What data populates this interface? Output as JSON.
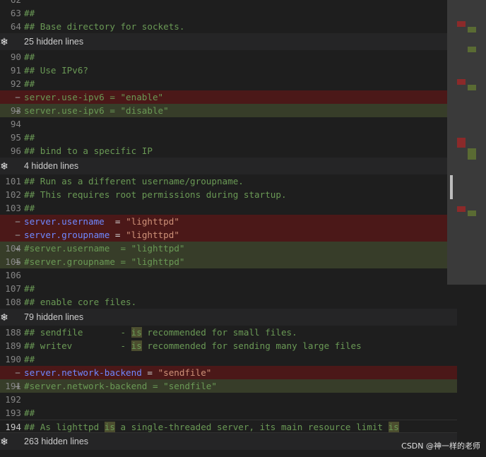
{
  "rows": [
    {
      "num": "62",
      "marker": "",
      "kind": "plain",
      "text": ""
    },
    {
      "num": "63",
      "marker": "",
      "kind": "plain",
      "text": "##"
    },
    {
      "num": "64",
      "marker": "",
      "kind": "plain",
      "text": "## Base directory for sockets."
    },
    {
      "fold": "25 hidden lines"
    },
    {
      "num": "90",
      "marker": "",
      "kind": "plain",
      "text": "##"
    },
    {
      "num": "91",
      "marker": "",
      "kind": "plain",
      "text": "## Use IPv6?"
    },
    {
      "num": "92",
      "marker": "",
      "kind": "plain",
      "text": "##"
    },
    {
      "num": "",
      "marker": "−",
      "kind": "del",
      "text": "server.use-ipv6 = \"enable\""
    },
    {
      "num": "93",
      "marker": "+",
      "kind": "add",
      "text": "server.use-ipv6 = \"disable\""
    },
    {
      "num": "94",
      "marker": "",
      "kind": "plain",
      "text": ""
    },
    {
      "num": "95",
      "marker": "",
      "kind": "plain",
      "text": "##"
    },
    {
      "num": "96",
      "marker": "",
      "kind": "plain",
      "text": "## bind to a specific IP"
    },
    {
      "fold": "4 hidden lines"
    },
    {
      "num": "101",
      "marker": "",
      "kind": "plain",
      "text": "## Run as a different username/groupname."
    },
    {
      "num": "102",
      "marker": "",
      "kind": "plain",
      "text": "## This requires root permissions during startup."
    },
    {
      "num": "103",
      "marker": "",
      "kind": "plain",
      "text": "##"
    },
    {
      "num": "",
      "marker": "−",
      "kind": "del",
      "text": "server.username  = \"lighttpd\""
    },
    {
      "num": "",
      "marker": "−",
      "kind": "del",
      "text": "server.groupname = \"lighttpd\""
    },
    {
      "num": "104",
      "marker": "+",
      "kind": "add",
      "text": "#server.username  = \"lighttpd\""
    },
    {
      "num": "105",
      "marker": "+",
      "kind": "add",
      "text": "#server.groupname = \"lighttpd\""
    },
    {
      "num": "106",
      "marker": "",
      "kind": "plain",
      "text": ""
    },
    {
      "num": "107",
      "marker": "",
      "kind": "plain",
      "text": "##"
    },
    {
      "num": "108",
      "marker": "",
      "kind": "plain",
      "text": "## enable core files."
    },
    {
      "fold": "79 hidden lines"
    },
    {
      "num": "188",
      "marker": "",
      "kind": "plain",
      "text": "## sendfile       - is recommended for small files."
    },
    {
      "num": "189",
      "marker": "",
      "kind": "plain",
      "text": "## writev         - is recommended for sending many large files"
    },
    {
      "num": "190",
      "marker": "",
      "kind": "plain",
      "text": "##"
    },
    {
      "num": "",
      "marker": "−",
      "kind": "del",
      "text": "server.network-backend = \"sendfile\""
    },
    {
      "num": "191",
      "marker": "+",
      "kind": "add",
      "text": "#server.network-backend = \"sendfile\""
    },
    {
      "num": "192",
      "marker": "",
      "kind": "plain",
      "text": ""
    },
    {
      "num": "193",
      "marker": "",
      "kind": "plain",
      "text": "##"
    },
    {
      "num": "194",
      "marker": "",
      "kind": "plain",
      "text": "## As lighttpd is a single-threaded server, its main resource limit is",
      "current": true
    },
    {
      "fold": "263 hidden lines"
    }
  ],
  "colors": {
    "deleted": "#4b1818",
    "added": "#373d29",
    "background": "#1e1e1e"
  },
  "watermark": "CSDN @神一样的老师"
}
